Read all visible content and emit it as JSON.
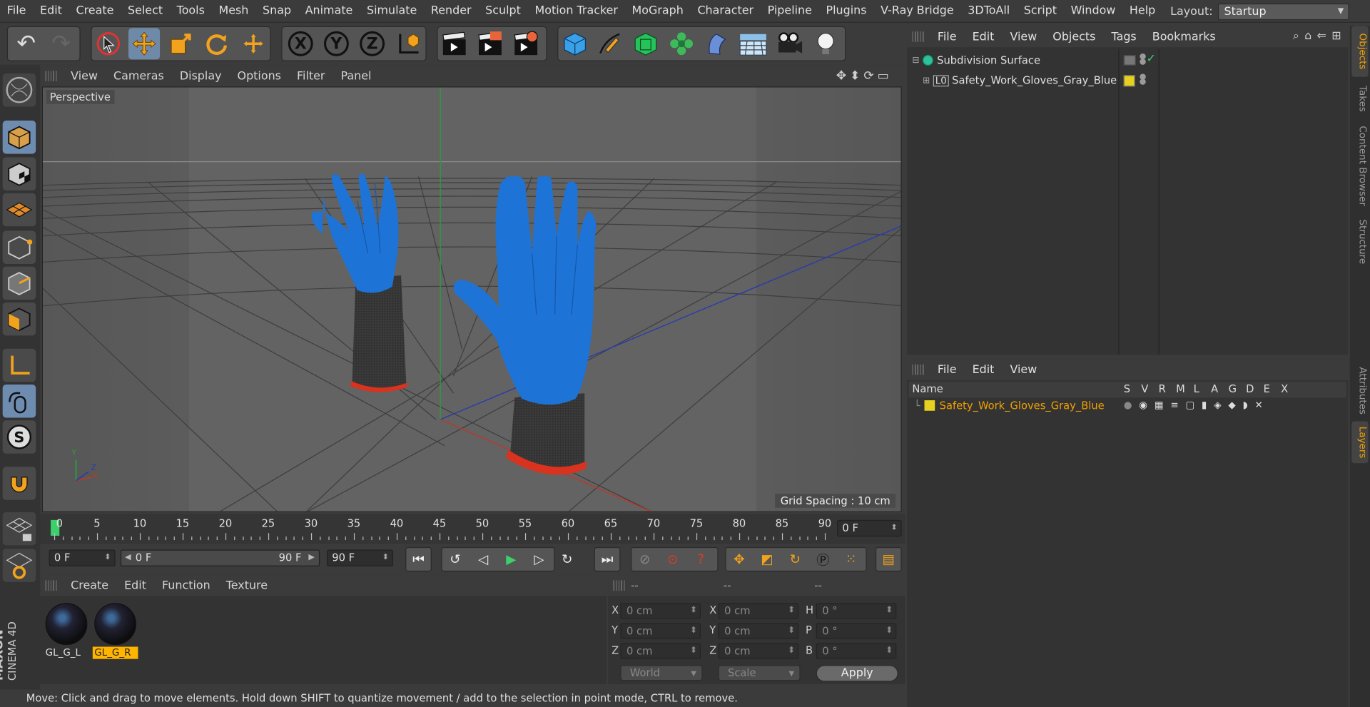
{
  "menubar": {
    "items": [
      "File",
      "Edit",
      "Create",
      "Select",
      "Tools",
      "Mesh",
      "Snap",
      "Animate",
      "Simulate",
      "Render",
      "Sculpt",
      "Motion Tracker",
      "MoGraph",
      "Character",
      "Pipeline",
      "Plugins",
      "V-Ray Bridge",
      "3DToAll",
      "Script",
      "Window",
      "Help"
    ],
    "layout_label": "Layout:",
    "layout_value": "Startup"
  },
  "toolbar": {
    "axis_x": "X",
    "axis_y": "Y",
    "axis_z": "Z"
  },
  "viewport": {
    "menu": [
      "View",
      "Cameras",
      "Display",
      "Options",
      "Filter",
      "Panel"
    ],
    "label": "Perspective",
    "grid_spacing": "Grid Spacing : 10 cm",
    "axis_x": "X",
    "axis_y": "Y",
    "axis_z": "Z"
  },
  "timeline": {
    "ticks": [
      "0",
      "5",
      "10",
      "15",
      "20",
      "25",
      "30",
      "35",
      "40",
      "45",
      "50",
      "55",
      "60",
      "65",
      "70",
      "75",
      "80",
      "85",
      "90"
    ],
    "current_frame": "0 F"
  },
  "transport": {
    "start_field": "0 F",
    "range_start": "0 F",
    "range_end": "90 F",
    "end_field": "90 F"
  },
  "materials": {
    "menu": [
      "Create",
      "Edit",
      "Function",
      "Texture"
    ],
    "items": [
      {
        "name": "GL_G_L",
        "active": false
      },
      {
        "name": "GL_G_R",
        "active": true
      }
    ]
  },
  "coordinates": {
    "headers": [
      "--",
      "--",
      "--"
    ],
    "rows": [
      {
        "a_label": "X",
        "a": "0 cm",
        "b_label": "X",
        "b": "0 cm",
        "c_label": "H",
        "c": "0 °"
      },
      {
        "a_label": "Y",
        "a": "0 cm",
        "b_label": "Y",
        "b": "0 cm",
        "c_label": "P",
        "c": "0 °"
      },
      {
        "a_label": "Z",
        "a": "0 cm",
        "b_label": "Z",
        "b": "0 cm",
        "c_label": "B",
        "c": "0 °"
      }
    ],
    "mode": "World",
    "scale": "Scale",
    "apply": "Apply"
  },
  "status": "Move: Click and drag to move elements. Hold down SHIFT to quantize movement / add to the selection in point mode, CTRL to remove.",
  "brand": {
    "maxon": "MAXON",
    "product": "CINEMA 4D"
  },
  "objects": {
    "menu": [
      "File",
      "Edit",
      "View",
      "Objects",
      "Tags",
      "Bookmarks"
    ],
    "tree": [
      {
        "name": "Subdivision Surface",
        "level": 0
      },
      {
        "name": "Safety_Work_Gloves_Gray_Blue",
        "level": 1
      }
    ]
  },
  "layers": {
    "menu": [
      "File",
      "Edit",
      "View"
    ],
    "columns": [
      "Name",
      "S",
      "V",
      "R",
      "M",
      "L",
      "A",
      "G",
      "D",
      "E",
      "X"
    ],
    "rows": [
      {
        "name": "Safety_Work_Gloves_Gray_Blue"
      }
    ]
  },
  "sidetabs": [
    "Objects",
    "Takes",
    "Content Browser",
    "Structure",
    "Attributes",
    "Layers"
  ],
  "colors": {
    "accent": "#f0a000",
    "selection": "#6f8aa8",
    "glove_blue": "#1e73d6",
    "layer_yellow": "#e6d21e"
  }
}
